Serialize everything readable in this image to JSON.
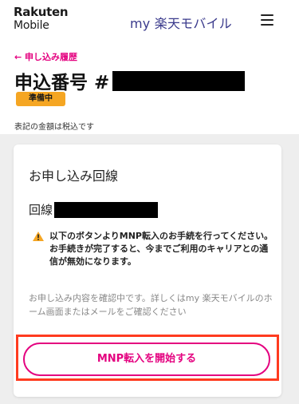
{
  "header": {
    "logo_line1": "Rakuten",
    "logo_line2": "Mobile",
    "title": "my 楽天モバイル",
    "menu_icon": "hamburger-menu-icon"
  },
  "back_link": "← 申し込み履歴",
  "page_title": "申込番号 #",
  "status_badge": "準備中",
  "tax_note": "表記の金額は税込です",
  "card": {
    "title": "お申し込み回線",
    "line_label": "回線",
    "notice_icon": "warning-icon",
    "notice_text": "以下のボタンよりMNP転入のお手続を行ってください。お手続きが完了すると、今までご利用のキャリアとの通信が無効になります。",
    "confirm_text": "お申し込み内容を確認中です。詳しくはmy 楽天モバイルのホーム画面またはメールをご確認ください",
    "mnp_button": "MNP転入を開始する"
  },
  "colors": {
    "brand_pink": "#e4007f",
    "badge_orange": "#f5a623",
    "highlight_red": "#ff3b1f",
    "header_title": "#3a3a8c"
  }
}
